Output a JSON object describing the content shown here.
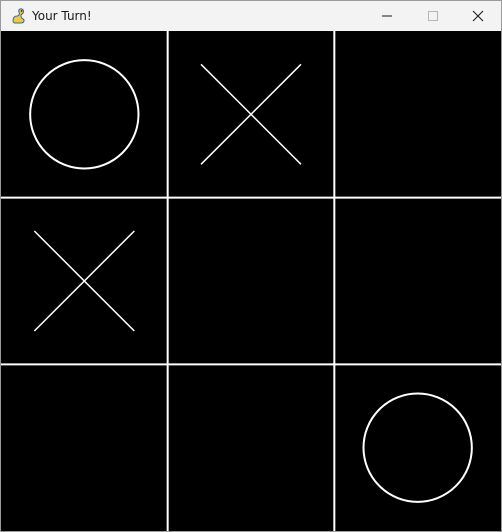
{
  "window": {
    "title": "Your Turn!",
    "app_icon": "pygame-snake-icon",
    "controls": [
      "minimize-icon",
      "maximize-icon",
      "close-icon"
    ]
  },
  "board": {
    "background_color": "#000000",
    "line_color": "#ffffff",
    "rows": 3,
    "cols": 3,
    "cells": [
      [
        "O",
        "X",
        ""
      ],
      [
        "X",
        "",
        ""
      ],
      [
        "",
        "",
        "O"
      ]
    ]
  }
}
